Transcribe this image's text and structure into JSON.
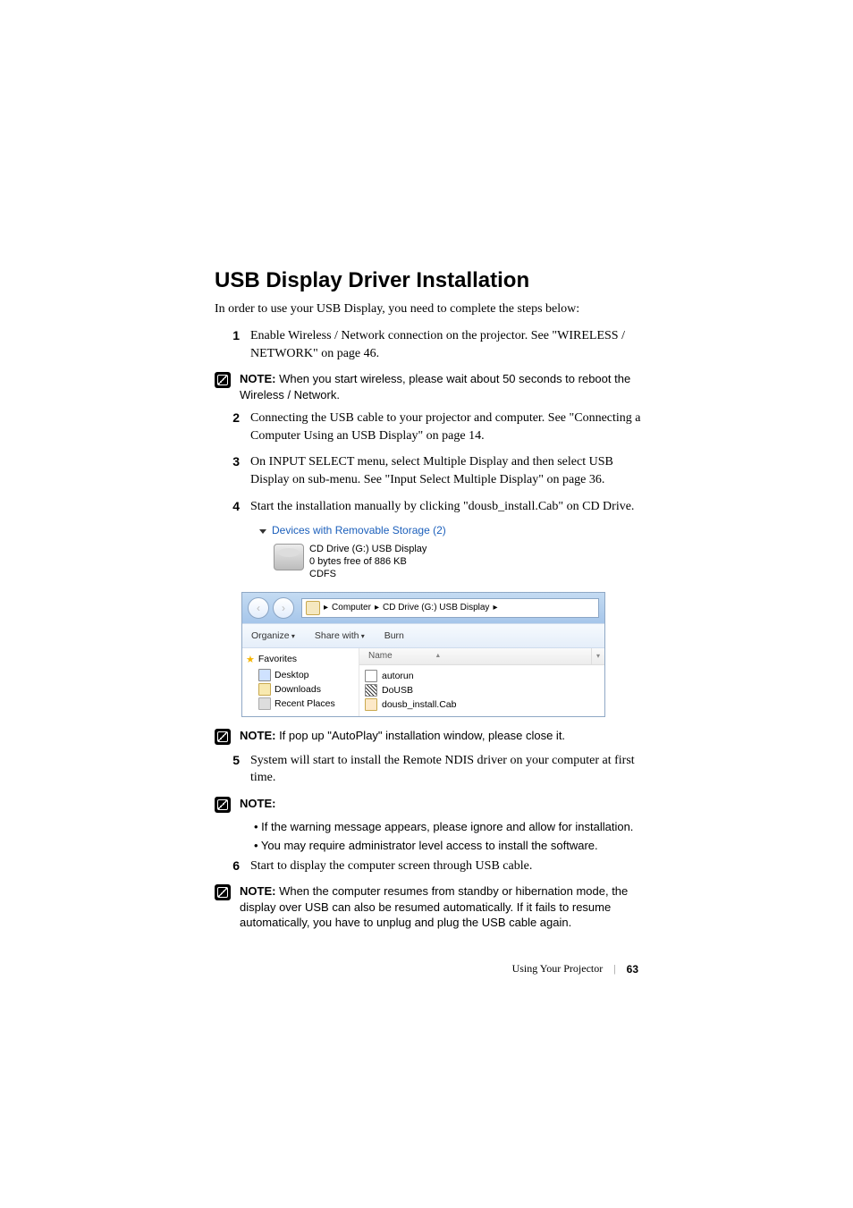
{
  "heading": "USB Display Driver Installation",
  "intro": "In order to use your USB Display, you need to complete the steps below:",
  "steps": {
    "n1": "1",
    "t1": "Enable Wireless / Network connection on the projector. See \"WIRELESS / NETWORK\" on page 46.",
    "n2": "2",
    "t2": "Connecting the USB cable to your projector and computer. See \"Connecting a Computer Using an USB Display\" on page 14.",
    "n3": "3",
    "t3": "On INPUT SELECT menu, select Multiple Display and then select USB Display on sub-menu. See \"Input Select Multiple Display\" on page 36.",
    "n4": "4",
    "t4": "Start the installation manually by clicking \"dousb_install.Cab\" on CD Drive.",
    "n5": "5",
    "t5": "System will start to install the Remote NDIS driver on your computer at first time.",
    "n6": "6",
    "t6": "Start to display the computer screen through USB cable."
  },
  "notes": {
    "label": "NOTE:",
    "note1": " When you start wireless, please wait about 50 seconds to reboot the Wireless / Network.",
    "note2": " If pop up \"AutoPlay\" installation window, please close it.",
    "note3_bullets": {
      "b1": "• If the warning message appears, please ignore and allow for installation.",
      "b2": "• You may require administrator level access to install the software."
    },
    "note4": " When the computer resumes from standby or hibernation mode, the display over USB can also be resumed automatically. If it fails to resume automatically, you have to unplug and plug the USB cable again."
  },
  "shot1": {
    "header": "Devices with Removable Storage (2)",
    "line1": "CD Drive (G:) USB Display",
    "line2": "0 bytes free of 886 KB",
    "line3": "CDFS"
  },
  "shot2": {
    "crumb1": "Computer",
    "crumb2": "CD Drive (G:) USB Display",
    "tb_organize": "Organize",
    "tb_share": "Share with",
    "tb_burn": "Burn",
    "col_name": "Name",
    "fav": "Favorites",
    "nav_desktop": "Desktop",
    "nav_downloads": "Downloads",
    "nav_recent": "Recent Places",
    "f1": "autorun",
    "f2": "DoUSB",
    "f3": "dousb_install.Cab"
  },
  "footer": {
    "section": "Using Your Projector",
    "page": "63"
  }
}
